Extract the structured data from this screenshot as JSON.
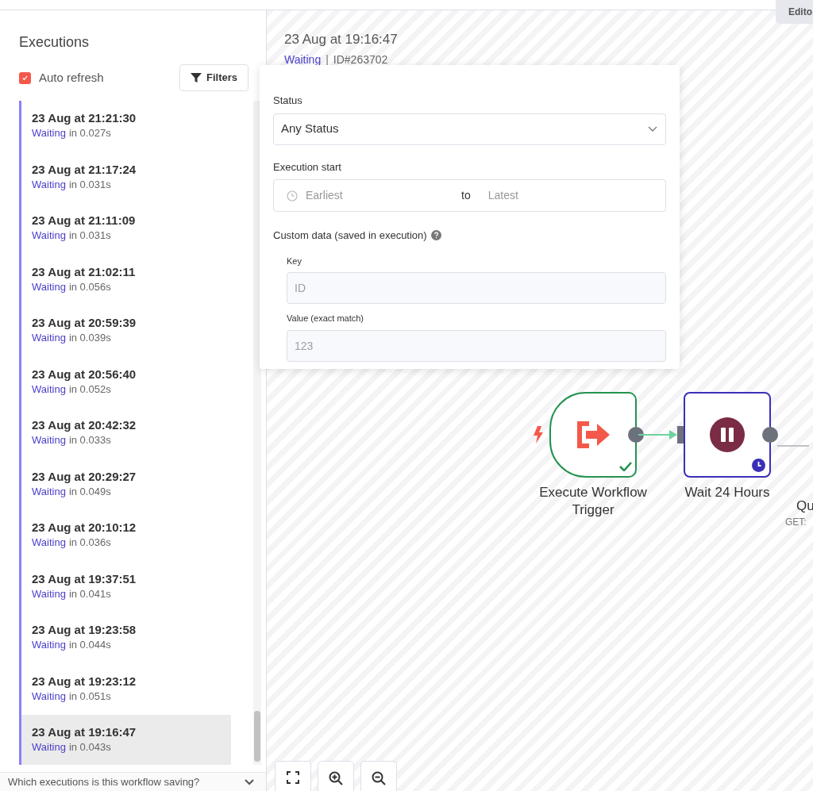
{
  "top_tab": {
    "label": "Edito"
  },
  "sidebar": {
    "title": "Executions",
    "auto_refresh": {
      "label": "Auto refresh",
      "checked": true
    },
    "filters_button": "Filters",
    "executions": [
      {
        "time": "23 Aug at 21:21:30",
        "status": "Waiting",
        "duration": "in 0.027s",
        "selected": false
      },
      {
        "time": "23 Aug at 21:17:24",
        "status": "Waiting",
        "duration": "in 0.031s",
        "selected": false
      },
      {
        "time": "23 Aug at 21:11:09",
        "status": "Waiting",
        "duration": "in 0.031s",
        "selected": false
      },
      {
        "time": "23 Aug at 21:02:11",
        "status": "Waiting",
        "duration": "in 0.056s",
        "selected": false
      },
      {
        "time": "23 Aug at 20:59:39",
        "status": "Waiting",
        "duration": "in 0.039s",
        "selected": false
      },
      {
        "time": "23 Aug at 20:56:40",
        "status": "Waiting",
        "duration": "in 0.052s",
        "selected": false
      },
      {
        "time": "23 Aug at 20:42:32",
        "status": "Waiting",
        "duration": "in 0.033s",
        "selected": false
      },
      {
        "time": "23 Aug at 20:29:27",
        "status": "Waiting",
        "duration": "in 0.049s",
        "selected": false
      },
      {
        "time": "23 Aug at 20:10:12",
        "status": "Waiting",
        "duration": "in 0.036s",
        "selected": false
      },
      {
        "time": "23 Aug at 19:37:51",
        "status": "Waiting",
        "duration": "in 0.041s",
        "selected": false
      },
      {
        "time": "23 Aug at 19:23:58",
        "status": "Waiting",
        "duration": "in 0.044s",
        "selected": false
      },
      {
        "time": "23 Aug at 19:23:12",
        "status": "Waiting",
        "duration": "in 0.051s",
        "selected": false
      },
      {
        "time": "23 Aug at 19:16:47",
        "status": "Waiting",
        "duration": "in 0.043s",
        "selected": true
      }
    ],
    "footer": "Which executions is this workflow saving?"
  },
  "execution_header": {
    "time": "23 Aug at 19:16:47",
    "status": "Waiting",
    "separator": "|",
    "id": "ID#263702"
  },
  "filter_popover": {
    "status_label": "Status",
    "status_value": "Any Status",
    "start_label": "Execution start",
    "start_from_placeholder": "Earliest",
    "start_to": "to",
    "start_to_placeholder": "Latest",
    "custom_label": "Custom data (saved in execution)",
    "key_label": "Key",
    "key_placeholder": "ID",
    "value_label": "Value (exact match)",
    "value_placeholder": "123"
  },
  "nodes": [
    {
      "kind": "trigger",
      "title": "Execute Workflow Trigger",
      "success": true
    },
    {
      "kind": "wait",
      "title": "Wait 24 Hours",
      "waiting": true
    },
    {
      "kind": "partial",
      "title": "Qu",
      "subtitle": "GET:"
    }
  ]
}
